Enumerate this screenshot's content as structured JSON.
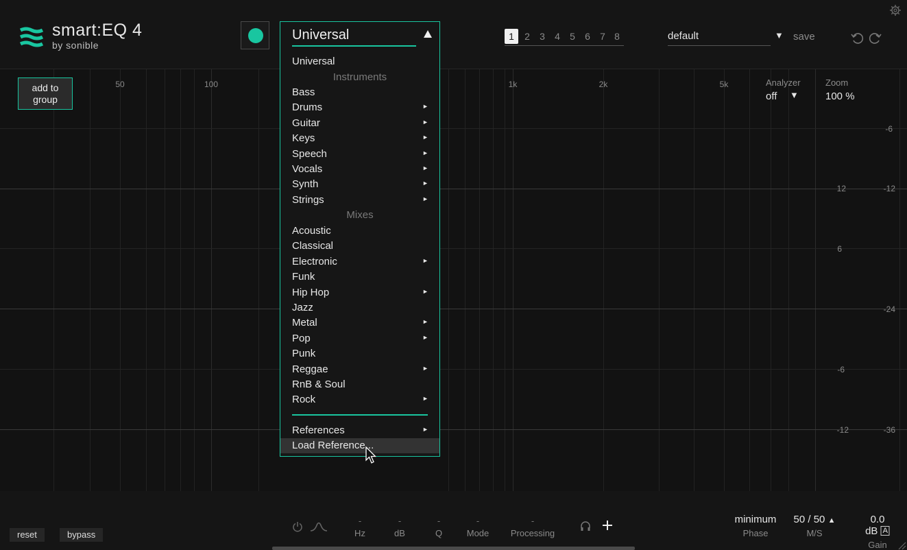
{
  "header": {
    "logo_title": "smart:EQ 4",
    "logo_by": "by sonible",
    "snapshots": [
      "1",
      "2",
      "3",
      "4",
      "5",
      "6",
      "7",
      "8"
    ],
    "active_snapshot": "1",
    "preset_name": "default",
    "save_label": "save"
  },
  "group_button": {
    "line1": "add to",
    "line2": "group"
  },
  "frequency_labels": [
    {
      "label": "50"
    },
    {
      "label": "100"
    },
    {
      "label": "1k"
    },
    {
      "label": "2k"
    },
    {
      "label": "5k"
    }
  ],
  "db_labels_inner": [
    "12",
    "6",
    "-6",
    "-12"
  ],
  "db_labels_outer": [
    "-6",
    "-12",
    "-24",
    "-36"
  ],
  "analyzer": {
    "label": "Analyzer",
    "value": "off"
  },
  "zoom": {
    "label": "Zoom",
    "value": "100 %"
  },
  "dropdown": {
    "selected": "Universal",
    "top_item": "Universal",
    "instruments_header": "Instruments",
    "instruments": [
      {
        "label": "Bass",
        "sub": false
      },
      {
        "label": "Drums",
        "sub": true
      },
      {
        "label": "Guitar",
        "sub": true
      },
      {
        "label": "Keys",
        "sub": true
      },
      {
        "label": "Speech",
        "sub": true
      },
      {
        "label": "Vocals",
        "sub": true
      },
      {
        "label": "Synth",
        "sub": true
      },
      {
        "label": "Strings",
        "sub": true
      }
    ],
    "mixes_header": "Mixes",
    "mixes": [
      {
        "label": "Acoustic",
        "sub": false
      },
      {
        "label": "Classical",
        "sub": false
      },
      {
        "label": "Electronic",
        "sub": true
      },
      {
        "label": "Funk",
        "sub": false
      },
      {
        "label": "Hip Hop",
        "sub": true
      },
      {
        "label": "Jazz",
        "sub": false
      },
      {
        "label": "Metal",
        "sub": true
      },
      {
        "label": "Pop",
        "sub": true
      },
      {
        "label": "Punk",
        "sub": false
      },
      {
        "label": "Reggae",
        "sub": true
      },
      {
        "label": "RnB & Soul",
        "sub": false
      },
      {
        "label": "Rock",
        "sub": true
      }
    ],
    "references": "References",
    "load_reference": "Load Reference...",
    "submenu_arrow": "►"
  },
  "footer": {
    "reset": "reset",
    "bypass": "bypass",
    "params": [
      {
        "value": "-",
        "label": "Hz"
      },
      {
        "value": "-",
        "label": "dB"
      },
      {
        "value": "-",
        "label": "Q"
      },
      {
        "value": "-",
        "label": "Mode"
      },
      {
        "value": "-",
        "label": "Processing"
      }
    ],
    "phase": {
      "value": "minimum",
      "label": "Phase"
    },
    "ms": {
      "value": "50 / 50",
      "label": "M/S"
    },
    "gain": {
      "value": "0.0 dB",
      "label": "Gain",
      "badge": "A"
    }
  },
  "colors": {
    "accent": "#19c6a0",
    "background": "#121212"
  }
}
